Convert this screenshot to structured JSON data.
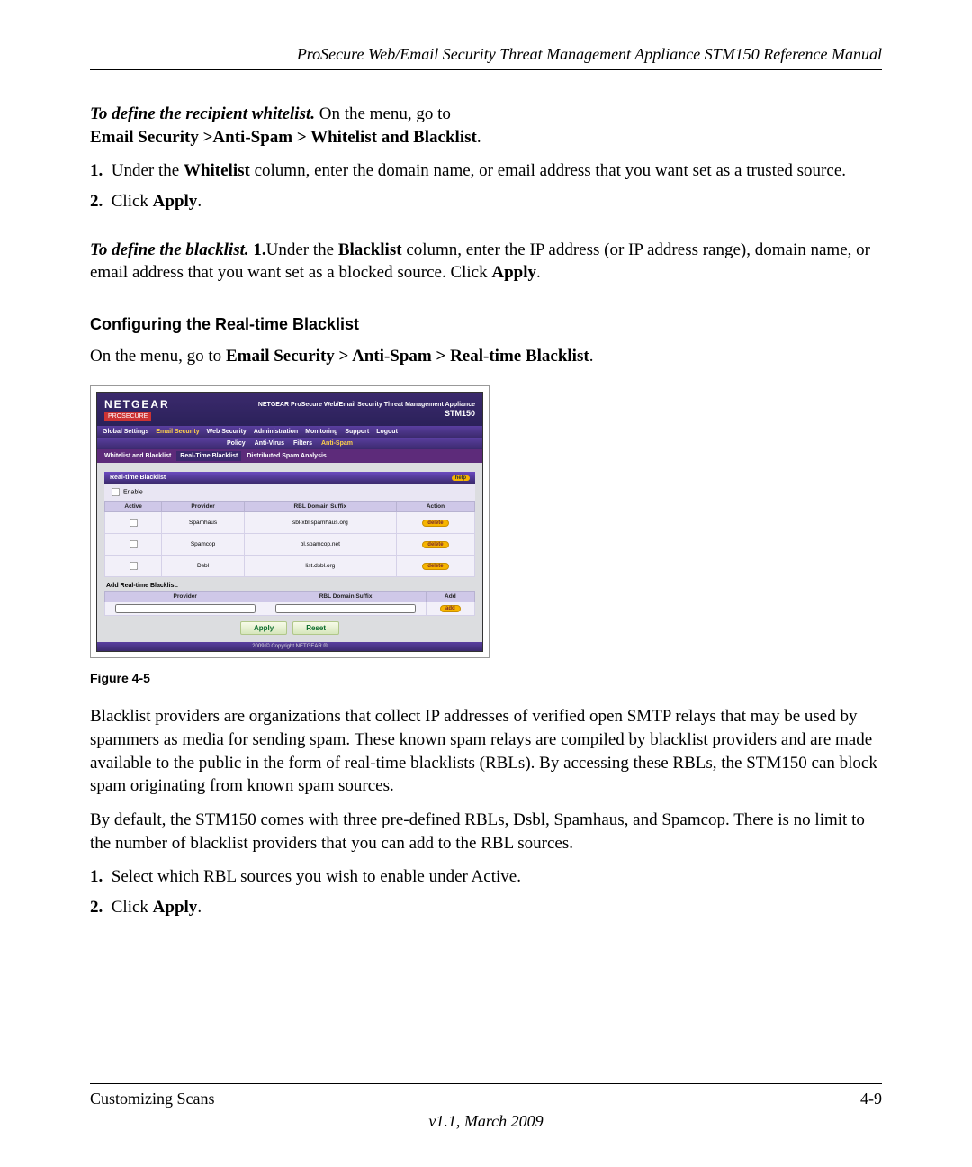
{
  "doc": {
    "header": "ProSecure Web/Email Security Threat Management Appliance STM150 Reference Manual",
    "footer_left": "Customizing Scans",
    "footer_right": "4-9",
    "footer_version": "v1.1, March 2009"
  },
  "whitelist": {
    "lead": "To define the recipient whitelist.",
    "lead_tail": " On the menu, go to ",
    "path": "Email Security >Anti-Spam > Whitelist and Blacklist",
    "period": ".",
    "step1_pre": "Under the ",
    "step1_b": "Whitelist",
    "step1_post": " column, enter the domain name, or email address that you want set as a trusted source.",
    "step2_pre": "Click ",
    "step2_b": "Apply",
    "step2_post": "."
  },
  "blacklist": {
    "lead": "To define the blacklist. ",
    "num": "1.",
    "pre": "Under the ",
    "b1": "Blacklist",
    "mid": " column, enter the IP address (or IP address range), domain name, or email address that you want set as a blocked source. Click ",
    "b2": "Apply",
    "post": "."
  },
  "rtbl": {
    "heading": "Configuring the Real-time Blacklist",
    "intro_pre": "On the menu, go to ",
    "intro_b": "Email Security > Anti-Spam > Real-time Blacklist",
    "intro_post": "."
  },
  "figure_label": "Figure 4-5",
  "para1": "Blacklist providers are organizations that collect IP addresses of verified open SMTP relays that may be used by spammers as media for sending spam. These known spam relays are compiled by blacklist providers and are made available to the public in the form of real-time blacklists (RBLs). By accessing these RBLs, the STM150 can block spam originating from known spam sources.",
  "para2": "By default, the STM150 comes with three pre-defined RBLs, Dsbl, Spamhaus, and Spamcop. There is no limit to the number of blacklist providers that you can add to the RBL sources.",
  "steps2": {
    "s1": "Select which RBL sources you wish to enable under Active.",
    "s2_pre": "Click ",
    "s2_b": "Apply",
    "s2_post": "."
  },
  "shot": {
    "logo": "NETGEAR",
    "tag": "PROSECURE",
    "title": "NETGEAR ProSecure Web/Email Security Threat Management Appliance",
    "model": "STM150",
    "nav1": [
      "Global Settings",
      "Email Security",
      "Web Security",
      "Administration",
      "Monitoring",
      "Support",
      "Logout"
    ],
    "nav1_active": 1,
    "nav2": [
      "Policy",
      "Anti-Virus",
      "Filters",
      "Anti-Spam"
    ],
    "nav2_active": 3,
    "tabs": [
      "Whitelist and Blacklist",
      "Real-Time Blacklist",
      "Distributed Spam Analysis"
    ],
    "tabs_active": 1,
    "panel_title": "Real-time Blacklist",
    "help": "help",
    "enable": "Enable",
    "th": [
      "Active",
      "Provider",
      "RBL Domain Suffix",
      "Action"
    ],
    "rows": [
      {
        "provider": "Spamhaus",
        "suffix": "sbl-xbl.spamhaus.org",
        "action": "delete"
      },
      {
        "provider": "Spamcop",
        "suffix": "bl.spamcop.net",
        "action": "delete"
      },
      {
        "provider": "Dsbl",
        "suffix": "list.dsbl.org",
        "action": "delete"
      }
    ],
    "add_label": "Add Real-time Blacklist:",
    "add_th": [
      "Provider",
      "RBL Domain Suffix",
      "Add"
    ],
    "add_btn": "add",
    "apply": "Apply",
    "reset": "Reset",
    "copyright": "2009 © Copyright NETGEAR ®"
  }
}
